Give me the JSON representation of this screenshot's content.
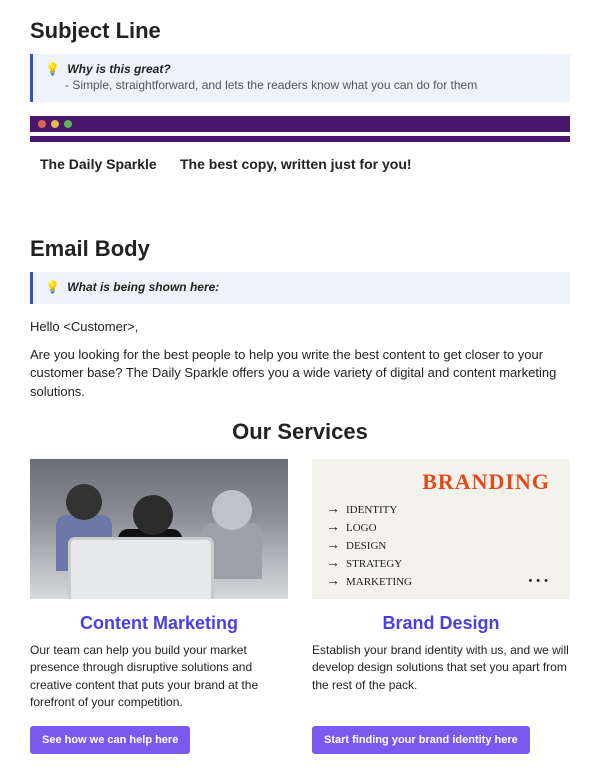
{
  "subjectLine": {
    "heading": "Subject Line",
    "callout": {
      "title": "Why is this great?",
      "sub": "- Simple, straightforward, and lets the readers know what you can do for them"
    }
  },
  "browserPreview": {
    "brand": "The Daily Sparkle",
    "tagline": "The best copy, written just for you!"
  },
  "emailBody": {
    "heading": "Email Body",
    "callout": {
      "title": "What is being shown here:"
    },
    "greeting": "Hello <Customer>,",
    "intro": "Are you looking for the best people to help you write the best content to get closer to your customer base? The Daily Sparkle offers you a wide variety of digital and content marketing solutions."
  },
  "services": {
    "heading": "Our Services",
    "cards": [
      {
        "title": "Content Marketing",
        "desc": "Our team can help you build your market presence through disruptive solutions and creative content that puts your brand at the forefront of your competition.",
        "cta": "See how we can help here"
      },
      {
        "title": "Brand Design",
        "desc": "Establish your brand identity with us, and we will develop design solutions that set you apart from the rest of the pack.",
        "cta": "Start finding your brand identity here"
      }
    ],
    "brandBoard": {
      "headline": "BRANDING",
      "items": [
        "IDENTITY",
        "LOGO",
        "DESIGN",
        "STRATEGY",
        "MARKETING"
      ]
    }
  }
}
